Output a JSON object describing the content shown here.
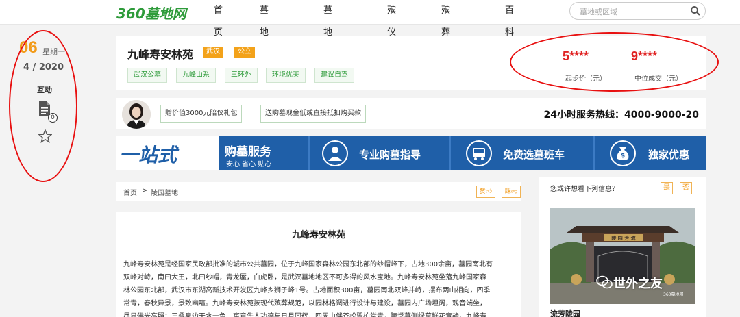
{
  "header": {
    "logo": "360墓地网",
    "nav": [
      "首页",
      "墓地陵园",
      "墓地地图",
      "殡仪馆",
      "殡葬服务",
      "百科"
    ],
    "search_placeholder": "墓地或区域"
  },
  "date": {
    "day": "06",
    "weekday": "星期一",
    "month_year": "4 / 2020"
  },
  "interact": {
    "label": "互动",
    "comment_count": "0"
  },
  "cemetery": {
    "name": "九峰寿安林苑",
    "tags": [
      "武汉",
      "公立"
    ],
    "features": [
      "武汉公墓",
      "九峰山系",
      "三环外",
      "环境优美",
      "建议自驾"
    ]
  },
  "prices": [
    {
      "value": "5****",
      "label": "起步价（元）"
    },
    {
      "value": "9****",
      "label": "中位成交（元）"
    }
  ],
  "consult": {
    "promos": [
      "赠价值3000元陪仪礼包",
      "送购墓现金低或直接抵扣购买款"
    ],
    "hotline": "24小时服务热线：4000-9000-20"
  },
  "banner": {
    "main": "一站式",
    "service_title": "购墓服务",
    "service_sub": "安心 省心 贴心",
    "items": [
      "专业购墓指导",
      "免费选墓班车",
      "独家优惠"
    ]
  },
  "breadcrumb": {
    "home": "首页",
    "sep": ">",
    "current": "陵园墓地",
    "like": "赞",
    "dislike": "踩"
  },
  "article": {
    "title": "九峰寿安林苑",
    "lines": [
      "九峰寿安林苑是经国家民政部批准的城市公共墓园，位于九峰国家森林公园东北部的纱帽峰下，占地300余亩，墓园南北有",
      "双峰对峙，南曰大王，北曰纱帽，青龙蜃，白虎卧，是武汉墓地地区不可多得的风水宝地。九峰寿安林苑坐落九峰国家森",
      "林公园东北部，武汉市东湖高新技术开发区九峰乡狮子峰1号。占地面积300亩，墓园南北双峰并峙，摆布两山相向，四季",
      "常青，春秋异景，景致幽喧。九峰寿安林苑按现代殡葬规范，以园林格调进行设计与建设，墓园内广场坦阔，观音端坐，",
      "尽显佛光高照：三叠泉边天水一色、寓意先人功德与日月同辉，四周山伴苍松翠柏常青，陵堂墓侧绿草鲜花竞艳。九峰寿"
    ]
  },
  "side": {
    "question": "您或许想看下列信息？",
    "yes": "是",
    "no": "否",
    "caption": "流芳陵园",
    "gate_sign": "陵 园 芳 流"
  },
  "watermark": {
    "text": "世外之友",
    "sub": "360墓地网"
  },
  "colors": {
    "brand_green": "#2e9b3a",
    "accent_orange": "#f3a21a",
    "banner_blue": "#1f5fa8",
    "price_red": "#e02424",
    "annotation_red": "#e81010"
  }
}
